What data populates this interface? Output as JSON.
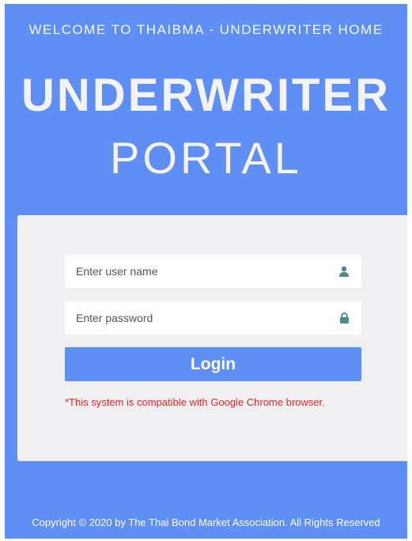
{
  "header": {
    "welcome": "WELCOME TO THAIBMA - UNDERWRITER HOME",
    "title_main": "UNDERWRITER",
    "title_sub": "PORTAL"
  },
  "login_form": {
    "username_placeholder": "Enter user name",
    "password_placeholder": "Enter password",
    "username_icon": "user-icon",
    "password_icon": "lock-icon",
    "login_label": "Login",
    "notice": "*This system is compatible with Google Chrome browser."
  },
  "footer": {
    "copyright": "Copyright © 2020 by The Thai Bond Market Association. All Rights Reserved"
  },
  "colors": {
    "background": "#5f8ff5",
    "card": "#f0f0f2",
    "button": "#5f8ff5",
    "icon": "#4a8a8a",
    "notice": "#ee2222"
  }
}
